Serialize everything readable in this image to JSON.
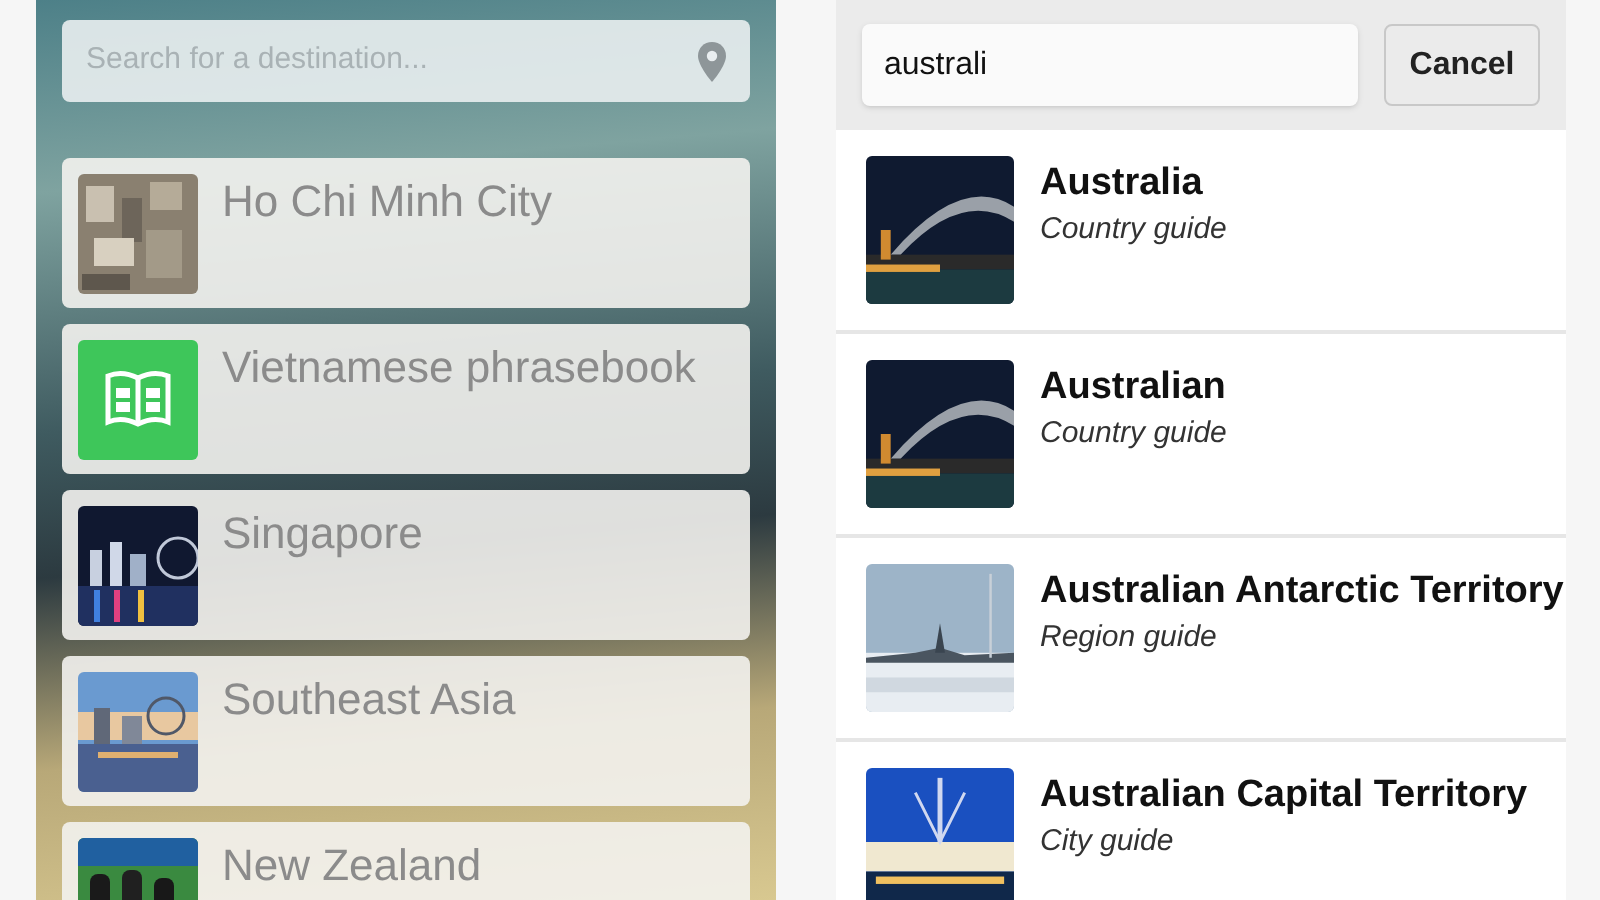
{
  "explore": {
    "search": {
      "placeholder": "Search for a destination..."
    },
    "items": [
      {
        "kind": "place",
        "label": "Ho Chi Minh City"
      },
      {
        "kind": "phrasebook",
        "label": "Vietnamese phrasebook"
      },
      {
        "kind": "place",
        "label": "Singapore"
      },
      {
        "kind": "place",
        "label": "Southeast Asia"
      },
      {
        "kind": "place",
        "label": "New Zealand"
      }
    ]
  },
  "search_results": {
    "search": {
      "value": "australi"
    },
    "cancel": "Cancel",
    "results": [
      {
        "title": "Australia",
        "subtitle": "Country guide"
      },
      {
        "title": "Australian",
        "subtitle": "Country guide"
      },
      {
        "title": "Australian Antarctic Territory",
        "subtitle": "Region guide"
      },
      {
        "title": "Australian Capital Territory",
        "subtitle": "City guide"
      }
    ]
  }
}
